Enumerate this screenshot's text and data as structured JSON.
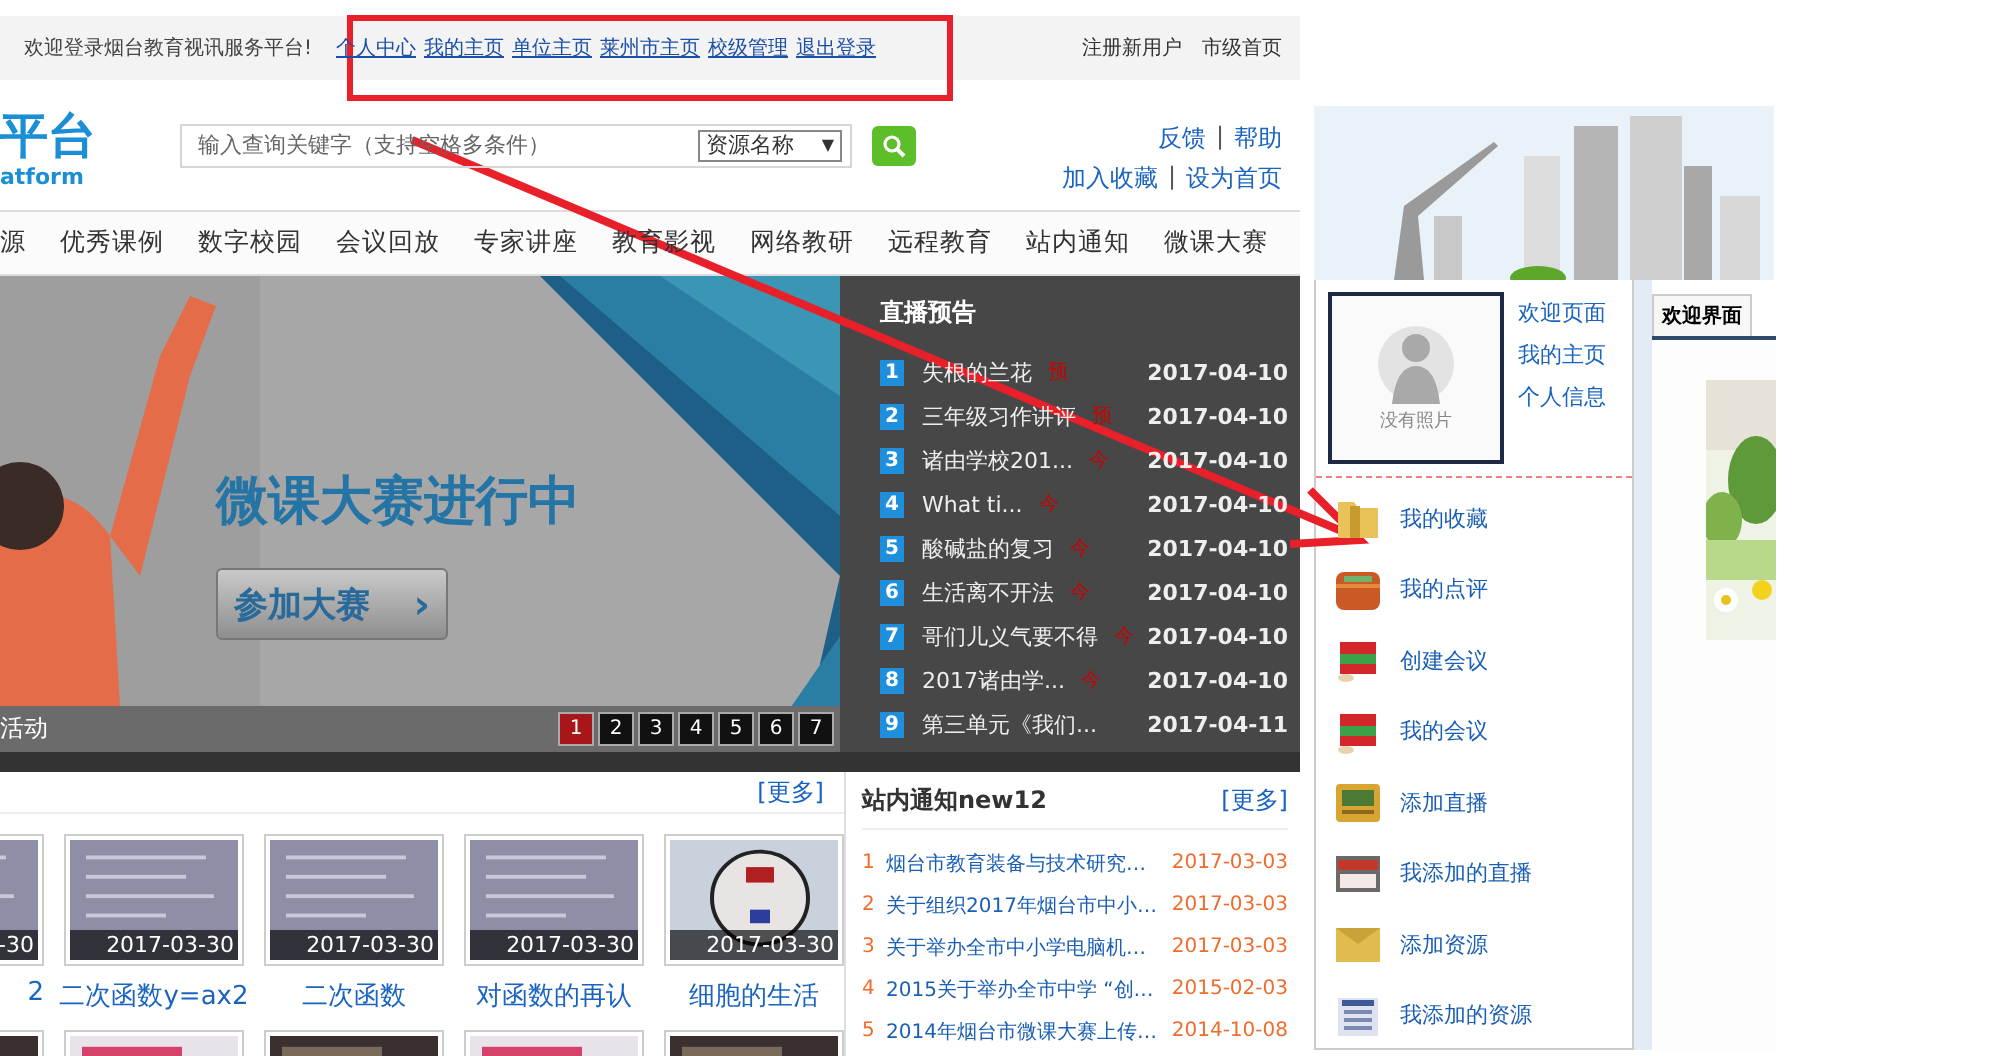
{
  "top_bar": {
    "welcome": "欢迎登录烟台教育视讯服务平台!",
    "links": [
      "个人中心",
      "我的主页",
      "单位主页",
      "莱州市主页",
      "校级管理",
      "退出登录"
    ],
    "right_links": [
      "注册新用户",
      "市级首页"
    ]
  },
  "header": {
    "logo_title": "平台",
    "logo_subtitle": "atform",
    "search": {
      "placeholder": "输入查询关键字（支持空格多条件）",
      "scope": "资源名称",
      "arrow": "▼"
    },
    "links_row1": [
      "反馈",
      "帮助"
    ],
    "links_row2": [
      "加入收藏",
      "设为首页"
    ],
    "separator": "|"
  },
  "nav": [
    "源",
    "优秀课例",
    "数字校园",
    "会议回放",
    "专家讲座",
    "教育影视",
    "网络教研",
    "远程教育",
    "站内通知",
    "微课大赛"
  ],
  "banner": {
    "headline": "微课大赛进行中",
    "button": "参加大赛",
    "button_arrow": "›",
    "caption": "活动",
    "pages": [
      {
        "label": "1",
        "selected": true
      },
      {
        "label": "2",
        "selected": false
      },
      {
        "label": "3",
        "selected": false
      },
      {
        "label": "4",
        "selected": false
      },
      {
        "label": "5",
        "selected": false
      },
      {
        "label": "6",
        "selected": false
      },
      {
        "label": "7",
        "selected": false
      }
    ]
  },
  "live": {
    "title": "直播预告",
    "items": [
      {
        "no": "1",
        "title": "失根的兰花",
        "tag": "预",
        "date": "2017-04-10"
      },
      {
        "no": "2",
        "title": "三年级习作讲评",
        "tag": "预",
        "date": "2017-04-10"
      },
      {
        "no": "3",
        "title": "诸由学校201...",
        "tag": "今",
        "date": "2017-04-10"
      },
      {
        "no": "4",
        "title": "What ti...",
        "tag": "今",
        "date": "2017-04-10"
      },
      {
        "no": "5",
        "title": "酸碱盐的复习",
        "tag": "今",
        "date": "2017-04-10"
      },
      {
        "no": "6",
        "title": "生活离不开法",
        "tag": "今",
        "date": "2017-04-10"
      },
      {
        "no": "7",
        "title": "哥们儿义气要不得",
        "tag": "今",
        "date": "2017-04-10"
      },
      {
        "no": "8",
        "title": "2017诸由学...",
        "tag": "今",
        "date": "2017-04-10"
      },
      {
        "no": "9",
        "title": "第三单元《我们...",
        "date": "2017-04-11"
      }
    ]
  },
  "videos": {
    "more": "[更多]",
    "items": [
      {
        "date": "-30",
        "caption": "2"
      },
      {
        "date": "2017-03-30",
        "caption": "二次函数y=ax2"
      },
      {
        "date": "2017-03-30",
        "caption": "二次函数"
      },
      {
        "date": "2017-03-30",
        "caption": "对函数的再认"
      },
      {
        "date": "2017-03-30",
        "caption": "细胞的生活"
      }
    ]
  },
  "notices": {
    "title": "站内通知new12",
    "more": "[更多]",
    "items": [
      {
        "no": "1",
        "title": "烟台市教育装备与技术研究…",
        "date": "2017-03-03"
      },
      {
        "no": "2",
        "title": "关于组织2017年烟台市中小…",
        "date": "2017-03-03"
      },
      {
        "no": "3",
        "title": "关于举办全市中小学电脑机…",
        "date": "2017-03-03"
      },
      {
        "no": "4",
        "title": "2015关于举办全市中学 “创…",
        "date": "2015-02-03"
      },
      {
        "no": "5",
        "title": "2014年烟台市微课大赛上传…",
        "date": "2014-10-08"
      }
    ]
  },
  "portal": {
    "avatar_text": "没有照片",
    "links": [
      "欢迎页面",
      "我的主页",
      "个人信息"
    ],
    "tab": "欢迎界面",
    "menu": [
      {
        "label": "我的收藏",
        "kind": "folder"
      },
      {
        "label": "我的点评",
        "kind": "wallet"
      },
      {
        "label": "创建会议",
        "kind": "books"
      },
      {
        "label": "我的会议",
        "kind": "books"
      },
      {
        "label": "添加直播",
        "kind": "toolbox"
      },
      {
        "label": "我添加的直播",
        "kind": "browser"
      },
      {
        "label": "添加资源",
        "kind": "envelope"
      },
      {
        "label": "我添加的资源",
        "kind": "list"
      }
    ]
  }
}
